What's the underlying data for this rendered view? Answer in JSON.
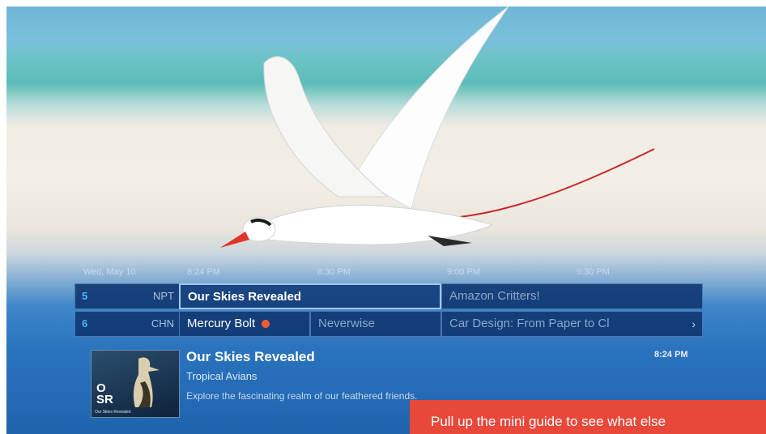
{
  "guide": {
    "date": "Wed, May 10",
    "times": [
      "8:24 PM",
      "8:30 PM",
      "9:00 PM",
      "9:30 PM"
    ],
    "channels": [
      {
        "number": "5",
        "name": "NPT",
        "programs": [
          "Our Skies Revealed",
          "Amazon Critters!"
        ]
      },
      {
        "number": "6",
        "name": "CHN",
        "programs": [
          "Mercury Bolt",
          "Neverwise",
          "Car Design: From Paper to Cl"
        ]
      }
    ]
  },
  "info": {
    "title": "Our Skies Revealed",
    "episode": "Tropical Avians",
    "description": "Explore the fascinating realm of our feathered friends.",
    "time": "8:24 PM",
    "thumbnail": {
      "logo_line1": "O",
      "logo_line2": "SR",
      "caption": "Our Skies Revealed"
    }
  },
  "toast": {
    "text": "Pull up the mini guide to see what else"
  },
  "icons": {
    "record": "record-dot-icon",
    "next": "chevron-right-icon"
  },
  "colors": {
    "record": "#ff5b2e",
    "toast": "#e8483a",
    "channel_number": "#4fb2ff"
  }
}
